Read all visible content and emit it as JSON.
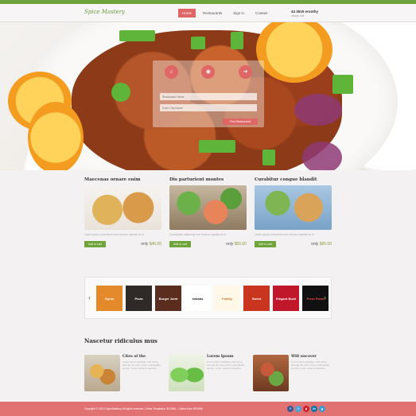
{
  "header": {
    "logo": "Spice Mastery",
    "nav": [
      {
        "label": "Home",
        "active": true
      },
      {
        "label": "Restaurants",
        "active": false
      },
      {
        "label": "Sign in",
        "active": false
      },
      {
        "label": "Contact",
        "active": false
      }
    ],
    "phone": "44 3515 ernothy",
    "phone_sub": "simply call"
  },
  "search": {
    "icons": [
      "restaurant-icon",
      "dish-icon",
      "delivery-icon"
    ],
    "restaurant_placeholder": "Restaurant Name",
    "city_placeholder": "Enter City Name",
    "button_label": "Find Restaurants"
  },
  "products": [
    {
      "title": "Maecenas ornare enim",
      "desc": "Lorem ipsum consectetur mos rhoncus egestas ac et",
      "add_label": "Add to cart",
      "price_prefix": "only",
      "price": "$45.00"
    },
    {
      "title": "Dis parturient montes",
      "desc": "Consectetur adipiscing mos rhoncus egestas ac et",
      "add_label": "Add to cart",
      "price_prefix": "only",
      "price": "$55.00"
    },
    {
      "title": "Curabitur congue blandit",
      "desc": "Lorem ipsum consectetur mos rhoncus egestas ac et",
      "add_label": "Add to cart",
      "price_prefix": "only",
      "price": "$65.00"
    }
  ],
  "brands": {
    "prev": "‹",
    "next": "›",
    "items": [
      "Gyros",
      "Pizza",
      "Burger Joint",
      "kebabs",
      "Family",
      "Sweet",
      "Elegant Bowl",
      "Pizza Pasta"
    ]
  },
  "features_title": "Nascetur ridiculus mus",
  "features": [
    {
      "title": "Cites of the",
      "text": "Lorem ipsum passage, and going through the cites of the undoubtable source. Lorem sections barelina"
    },
    {
      "title": "Lorem Ipsum",
      "text": "Lorem ipsum passage, and going through the cites of the undoubtable source. Lorem sections barelina"
    },
    {
      "title": "Will uncover",
      "text": "Lorem ipsum passage, and going through the cites of the undoubtable source. Lorem sections barelina"
    }
  ],
  "footer": {
    "text": "Copyright © 2013 SpiceMastery. All rights reserved. | More Templates: BOOMA - Collect from BOOMA",
    "socials": [
      "f",
      "t",
      "p",
      "in",
      "g"
    ]
  }
}
